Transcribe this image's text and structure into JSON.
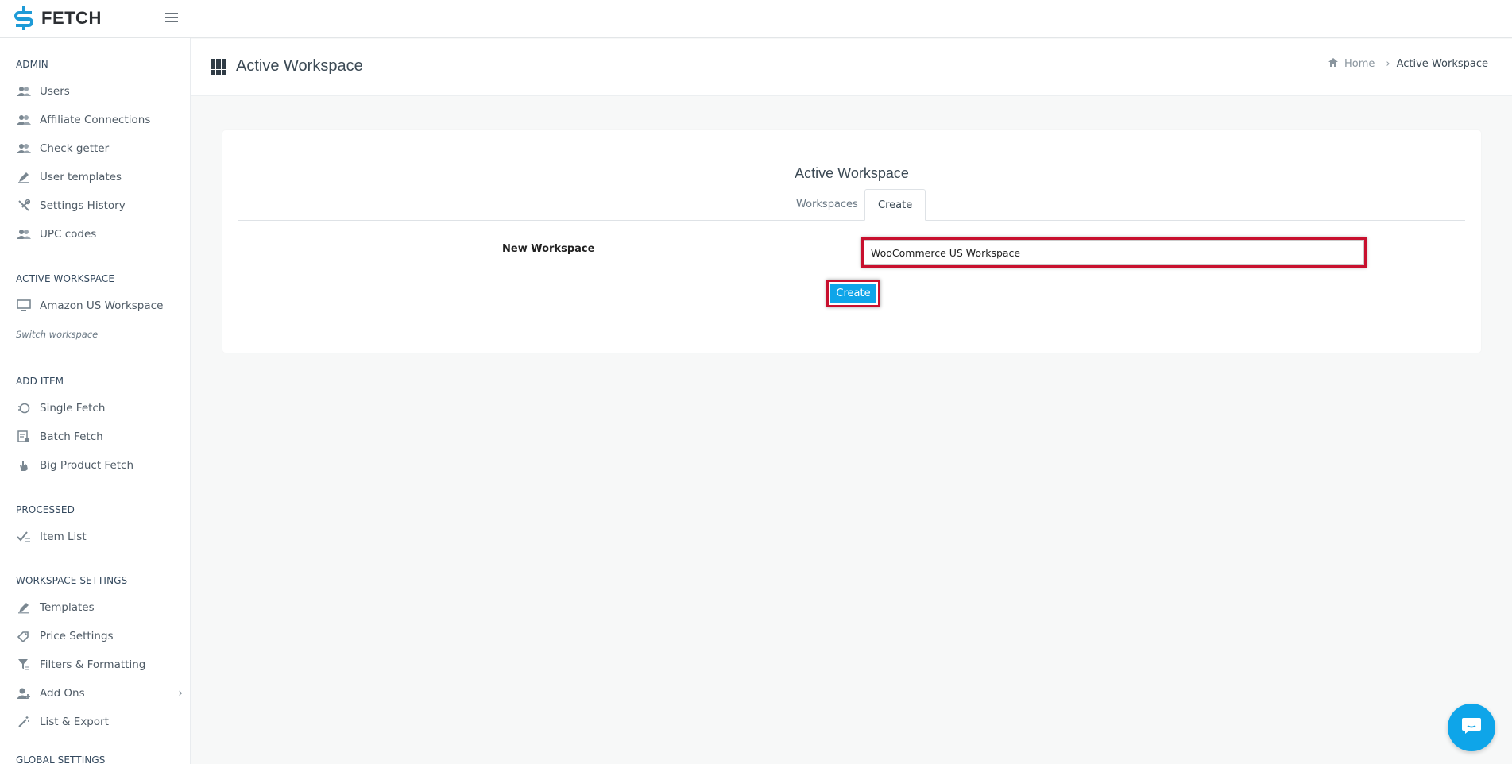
{
  "app": {
    "name": "FETCH",
    "brand_color": "#1e9bd7"
  },
  "sidebar": {
    "sections": [
      {
        "title": "ADMIN",
        "items": [
          {
            "label": "Users",
            "icon": "users-icon"
          },
          {
            "label": "Affiliate Connections",
            "icon": "users-icon"
          },
          {
            "label": "Check getter",
            "icon": "users-icon"
          },
          {
            "label": "User templates",
            "icon": "edit-icon"
          },
          {
            "label": "Settings History",
            "icon": "tools-icon"
          },
          {
            "label": "UPC codes",
            "icon": "users-icon"
          }
        ]
      },
      {
        "title": "ACTIVE WORKSPACE",
        "items": [
          {
            "label": "Amazon US Workspace",
            "icon": "monitor-icon"
          }
        ],
        "link": "Switch workspace"
      },
      {
        "title": "ADD ITEM",
        "items": [
          {
            "label": "Single Fetch",
            "icon": "fetch-icon"
          },
          {
            "label": "Batch Fetch",
            "icon": "batch-icon"
          },
          {
            "label": "Big Product Fetch",
            "icon": "hand-icon"
          }
        ]
      },
      {
        "title": "PROCESSED",
        "items": [
          {
            "label": "Item List",
            "icon": "checklist-icon"
          }
        ]
      },
      {
        "title": "WORKSPACE SETTINGS",
        "items": [
          {
            "label": "Templates",
            "icon": "edit-icon"
          },
          {
            "label": "Price Settings",
            "icon": "tag-icon"
          },
          {
            "label": "Filters & Formatting",
            "icon": "filter-icon"
          },
          {
            "label": "Add Ons",
            "icon": "user-add-icon"
          },
          {
            "label": "List & Export",
            "icon": "wand-icon"
          }
        ]
      },
      {
        "title": "GLOBAL SETTINGS",
        "items": []
      }
    ]
  },
  "header": {
    "title": "Active Workspace",
    "breadcrumb": {
      "home": "Home",
      "current": "Active Workspace"
    }
  },
  "card": {
    "title": "Active Workspace",
    "tabs": [
      "Workspaces",
      "Create"
    ],
    "active_tab": "Create",
    "form": {
      "label": "New Workspace",
      "value": "WooCommerce US Workspace",
      "button": "Create"
    }
  },
  "colors": {
    "highlight": "#c8102e",
    "button": "#0ea5e9"
  }
}
